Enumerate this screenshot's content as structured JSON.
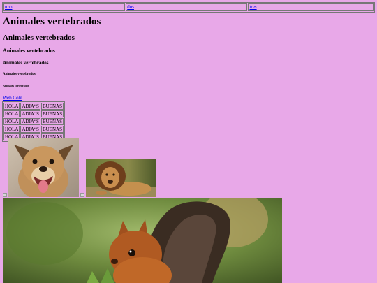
{
  "nav": {
    "links": [
      "uno",
      "dos",
      "tres"
    ]
  },
  "headings": {
    "h1": "Animales vertebrados",
    "h2": "Animales vertebrados",
    "h3": "Animales vertebrados",
    "h4": "Animales vertebrados",
    "h5": "Animales vertebrados",
    "h6": "Animales vertebrados"
  },
  "link": {
    "text": "Web Cole"
  },
  "table": {
    "rows": [
      [
        "HOLA",
        "ADIA“S",
        "BUENAS"
      ],
      [
        "HOLA",
        "ADIA“S",
        "BUENAS"
      ],
      [
        "HOLA",
        "ADIA“S",
        "BUENAS"
      ],
      [
        "HOLA",
        "ADIA“S",
        "BUENAS"
      ],
      [
        "HOLA",
        "ADIA“S",
        "BUENAS"
      ]
    ]
  },
  "images": {
    "dog": "dog-photo",
    "lion": "lion-photo",
    "squirrel": "squirrel-photo"
  },
  "colors": {
    "background": "#e8a8e8",
    "link": "#0000ee"
  }
}
